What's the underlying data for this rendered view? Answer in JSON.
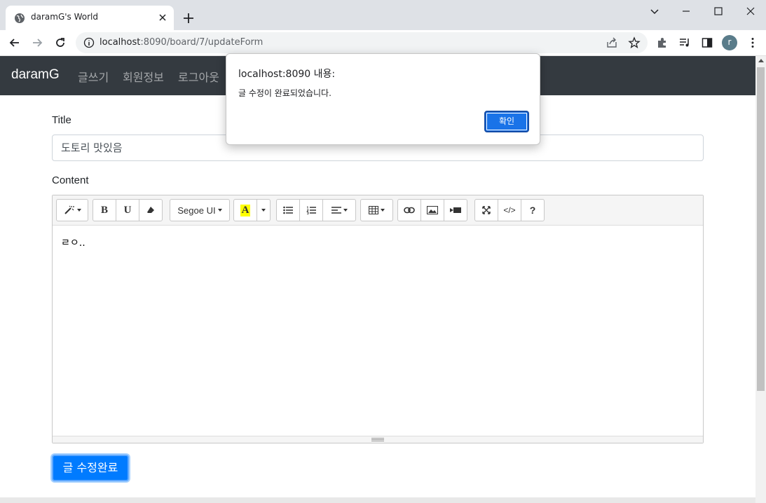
{
  "browser": {
    "tab_title": "daramG's World",
    "url_host": "localhost",
    "url_rest": ":8090/board/7/updateForm"
  },
  "profile_initial": "r",
  "navbar": {
    "brand": "daramG",
    "links": [
      "글쓰기",
      "회원정보",
      "로그아웃"
    ]
  },
  "form": {
    "title_label": "Title",
    "title_value": "도토리 맛있음",
    "content_label": "Content",
    "content_text": "ㄹㅇ..",
    "font_name": "Segoe UI",
    "submit_label": "글 수정완료"
  },
  "toolbar_icons": [
    "magic-icon",
    "bold-icon",
    "underline-icon",
    "eraser-icon",
    "font-family-dropdown",
    "font-color-icon",
    "color-dropdown",
    "unordered-list-icon",
    "ordered-list-icon",
    "align-icon",
    "table-icon",
    "link-icon",
    "picture-icon",
    "video-icon",
    "fullscreen-icon",
    "code-view-icon",
    "help-icon"
  ],
  "dialog": {
    "title": "localhost:8090 내용:",
    "message": "글 수정이 완료되었습니다.",
    "ok_label": "확인"
  },
  "colors": {
    "navbar_bg": "#343a40",
    "primary": "#007bff",
    "dialog_button": "#1a73e8"
  }
}
